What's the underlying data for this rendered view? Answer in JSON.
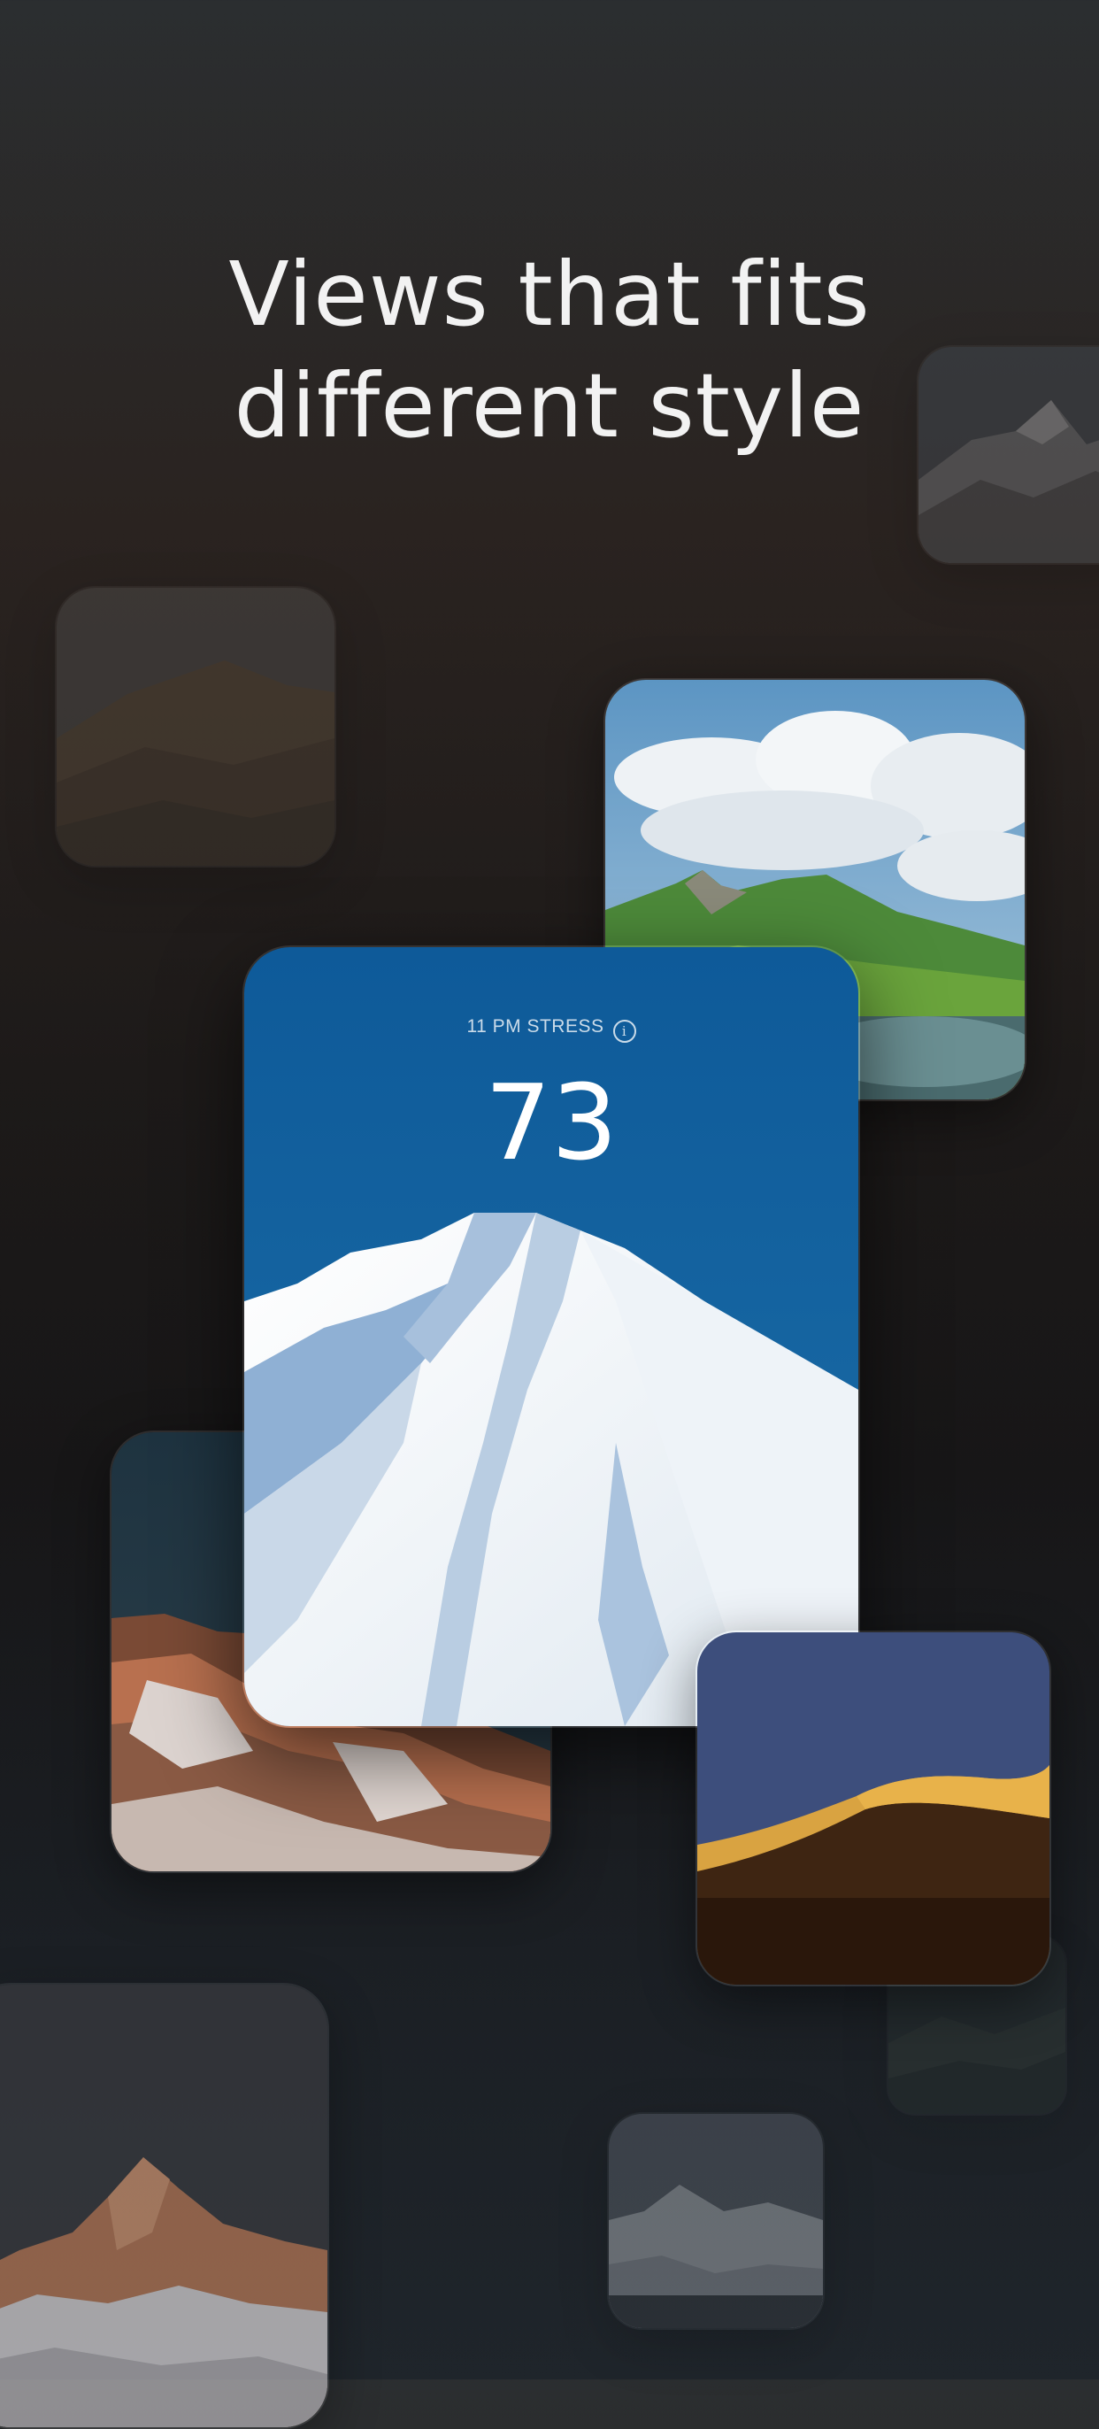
{
  "headline": {
    "line1": "Views that fits",
    "line2": "different style"
  },
  "main_card": {
    "label": "11 PM STRESS",
    "info_icon": "info-icon",
    "value": "73"
  },
  "cards": [
    "mountain-top-right-faded",
    "hills-left-faded",
    "green-valley-lake",
    "sunset-peaks",
    "desert-dune",
    "alpenglow-peak-faded",
    "snowy-range-faded",
    "small-forest-faded"
  ]
}
